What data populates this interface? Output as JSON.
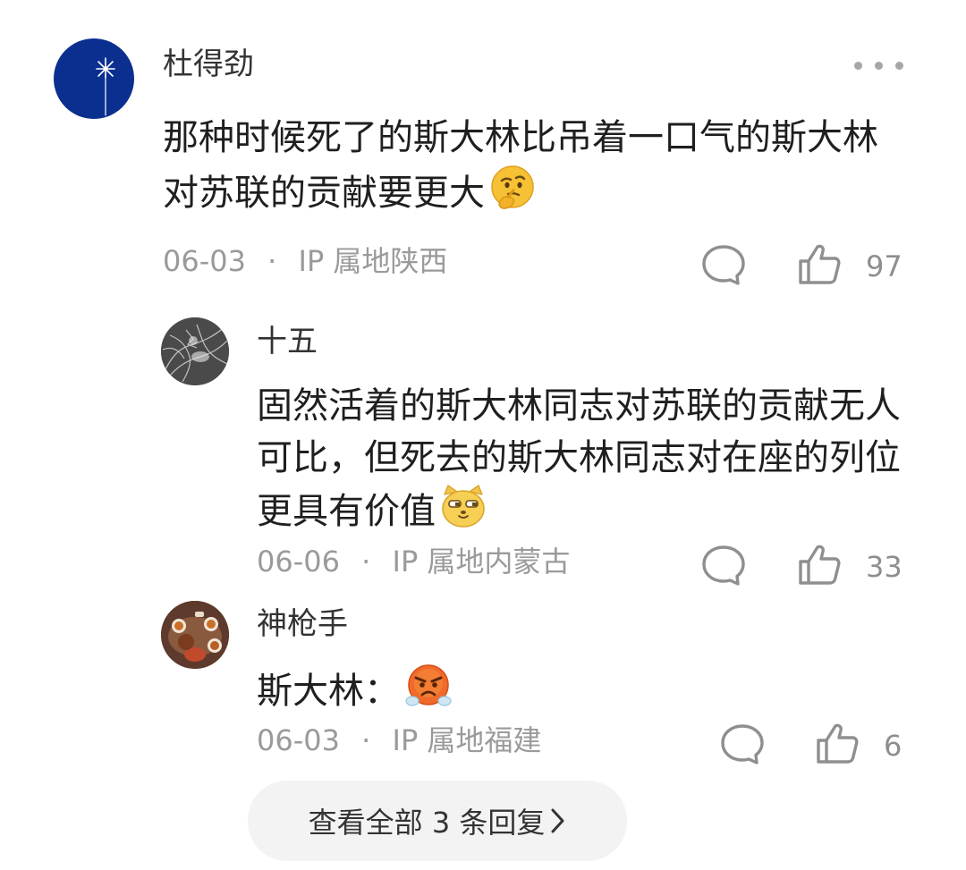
{
  "comment": {
    "author": "杜得劲",
    "content": "那种时候死了的斯大林比吊着一口气的斯大林对苏联的贡献要更大",
    "emoji": "thinking-face-icon",
    "date": "06-03",
    "separator": "·",
    "location": "IP 属地陕西",
    "likes": "97",
    "more_icon": "more-dots-icon"
  },
  "replies": [
    {
      "author": "十五",
      "content": "固然活着的斯大林同志对苏联的贡献无人可比，但死去的斯大林同志对在座的列位更具有价值",
      "emoji": "smug-cat-face-icon",
      "date": "06-06",
      "separator": "·",
      "location": "IP 属地内蒙古",
      "likes": "33"
    },
    {
      "author": "神枪手",
      "content": "斯大林：",
      "emoji": "angry-steam-face-icon",
      "date": "06-03",
      "separator": "·",
      "location": "IP 属地福建",
      "likes": "6"
    }
  ],
  "view_all_replies": "查看全部 3 条回复",
  "colors": {
    "avatar_blue": "#0b2f8f",
    "meta_gray": "#9a9a9a",
    "pill_bg": "#f3f3f3"
  }
}
